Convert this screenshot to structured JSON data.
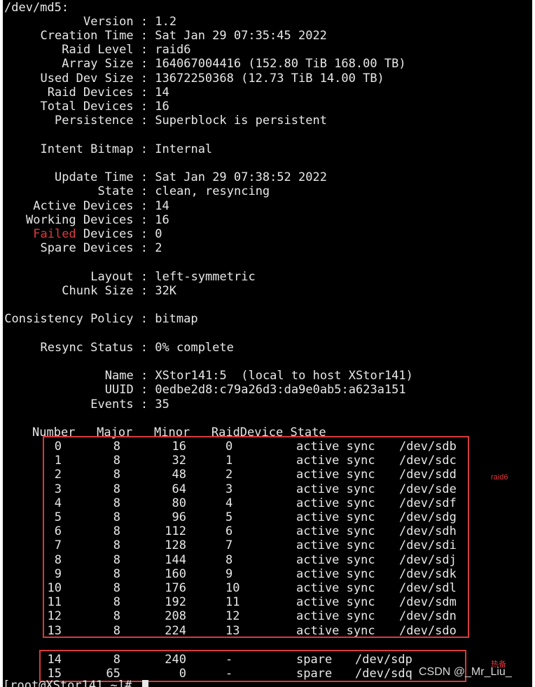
{
  "device": "/dev/md5:",
  "fields": [
    {
      "label": "Version",
      "value": "1.2"
    },
    {
      "label": "Creation Time",
      "value": "Sat Jan 29 07:35:45 2022"
    },
    {
      "label": "Raid Level",
      "value": "raid6"
    },
    {
      "label": "Array Size",
      "value": "164067004416 (152.80 TiB 168.00 TB)"
    },
    {
      "label": "Used Dev Size",
      "value": "13672250368 (12.73 TiB 14.00 TB)"
    },
    {
      "label": "Raid Devices",
      "value": "14"
    },
    {
      "label": "Total Devices",
      "value": "16"
    },
    {
      "label": "Persistence",
      "value": "Superblock is persistent"
    },
    {
      "label": "Intent Bitmap",
      "value": "Internal"
    },
    {
      "label": "Update Time",
      "value": "Sat Jan 29 07:38:52 2022"
    },
    {
      "label": "State",
      "value": "clean, resyncing"
    },
    {
      "label": "Active Devices",
      "value": "14"
    },
    {
      "label": "Working Devices",
      "value": "16"
    },
    {
      "label": "Failed Devices",
      "value": "0",
      "highlight": "Failed"
    },
    {
      "label": "Spare Devices",
      "value": "2"
    },
    {
      "label": "Layout",
      "value": "left-symmetric"
    },
    {
      "label": "Chunk Size",
      "value": "32K"
    },
    {
      "label": "Consistency Policy",
      "value": "bitmap"
    },
    {
      "label": "Resync Status",
      "value": "0% complete"
    },
    {
      "label": "Name",
      "value": "XStor141:5  (local to host XStor141)"
    },
    {
      "label": "UUID",
      "value": "0edbe2d8:c79a26d3:da9e0ab5:a623a151"
    },
    {
      "label": "Events",
      "value": "35"
    }
  ],
  "table": {
    "header": "Number   Major   Minor   RaidDevice State",
    "active_rows": [
      {
        "number": "0",
        "major": "8",
        "minor": "16",
        "raid": "0",
        "state": "active sync",
        "dev": "/dev/sdb"
      },
      {
        "number": "1",
        "major": "8",
        "minor": "32",
        "raid": "1",
        "state": "active sync",
        "dev": "/dev/sdc"
      },
      {
        "number": "2",
        "major": "8",
        "minor": "48",
        "raid": "2",
        "state": "active sync",
        "dev": "/dev/sdd"
      },
      {
        "number": "3",
        "major": "8",
        "minor": "64",
        "raid": "3",
        "state": "active sync",
        "dev": "/dev/sde"
      },
      {
        "number": "4",
        "major": "8",
        "minor": "80",
        "raid": "4",
        "state": "active sync",
        "dev": "/dev/sdf"
      },
      {
        "number": "5",
        "major": "8",
        "minor": "96",
        "raid": "5",
        "state": "active sync",
        "dev": "/dev/sdg"
      },
      {
        "number": "6",
        "major": "8",
        "minor": "112",
        "raid": "6",
        "state": "active sync",
        "dev": "/dev/sdh"
      },
      {
        "number": "7",
        "major": "8",
        "minor": "128",
        "raid": "7",
        "state": "active sync",
        "dev": "/dev/sdi"
      },
      {
        "number": "8",
        "major": "8",
        "minor": "144",
        "raid": "8",
        "state": "active sync",
        "dev": "/dev/sdj"
      },
      {
        "number": "9",
        "major": "8",
        "minor": "160",
        "raid": "9",
        "state": "active sync",
        "dev": "/dev/sdk"
      },
      {
        "number": "10",
        "major": "8",
        "minor": "176",
        "raid": "10",
        "state": "active sync",
        "dev": "/dev/sdl"
      },
      {
        "number": "11",
        "major": "8",
        "minor": "192",
        "raid": "11",
        "state": "active sync",
        "dev": "/dev/sdm"
      },
      {
        "number": "12",
        "major": "8",
        "minor": "208",
        "raid": "12",
        "state": "active sync",
        "dev": "/dev/sdn"
      },
      {
        "number": "13",
        "major": "8",
        "minor": "224",
        "raid": "13",
        "state": "active sync",
        "dev": "/dev/sdo"
      }
    ],
    "spare_rows": [
      {
        "number": "14",
        "major": "8",
        "minor": "240",
        "raid": "-",
        "state": "spare",
        "dev": "/dev/sdp"
      },
      {
        "number": "15",
        "major": "65",
        "minor": "0",
        "raid": "-",
        "state": "spare",
        "dev": "/dev/sdq"
      }
    ]
  },
  "annotations": {
    "raid6_note": "raid6",
    "hotspare_note": "热备"
  },
  "prompt": "[root@XStor141 ~]# ",
  "watermark": "CSDN @_Mr_Liu_",
  "colors": {
    "background": "#000000",
    "text": "#e8e8e8",
    "highlight": "#e0393e",
    "box": "#d93a3a"
  }
}
